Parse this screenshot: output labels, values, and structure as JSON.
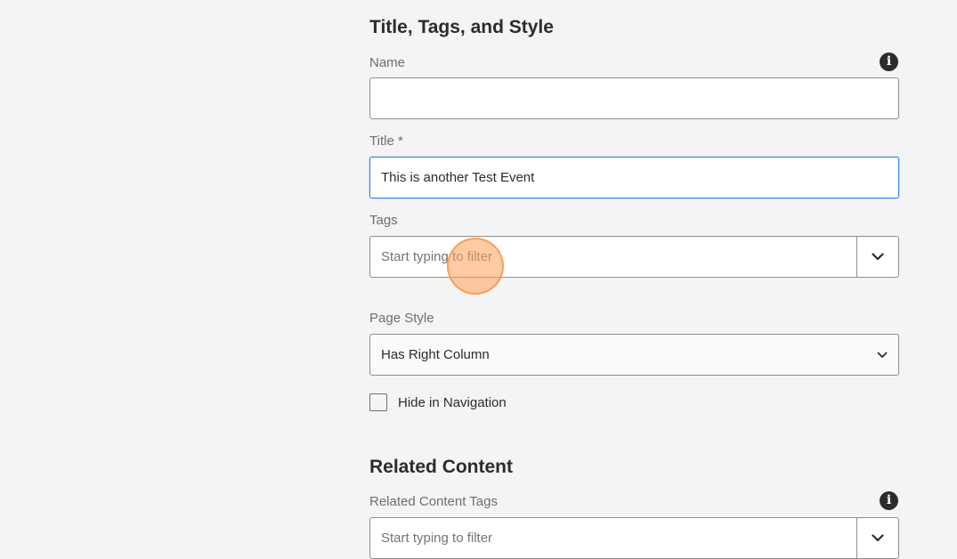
{
  "section_title": "Title, Tags, and Style",
  "name_field": {
    "label": "Name",
    "value": ""
  },
  "title_field": {
    "label": "Title *",
    "value": "This is another Test Event"
  },
  "tags_field": {
    "label": "Tags",
    "placeholder": "Start typing to filter"
  },
  "page_style": {
    "label": "Page Style",
    "selected": "Has Right Column"
  },
  "hide_in_navigation": {
    "label": "Hide in Navigation",
    "checked": false
  },
  "related_section_title": "Related Content",
  "related_tags_field": {
    "label": "Related Content Tags",
    "placeholder": "Start typing to filter"
  },
  "icons": {
    "info": "info-icon",
    "chevron": "chevron-down-icon"
  },
  "colors": {
    "background": "#f4f4f4",
    "focus_border": "#2680eb",
    "click_indicator": "#ffa05a"
  }
}
